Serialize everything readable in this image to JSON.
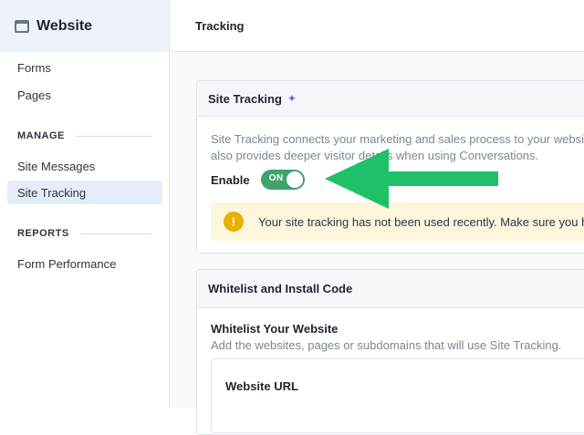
{
  "sidebar": {
    "title": "Website",
    "items": [
      {
        "label": "Forms"
      },
      {
        "label": "Pages"
      }
    ],
    "sections": [
      {
        "label": "MANAGE",
        "items": [
          {
            "label": "Site Messages"
          },
          {
            "label": "Site Tracking",
            "active": true
          }
        ]
      },
      {
        "label": "REPORTS",
        "items": [
          {
            "label": "Form Performance"
          }
        ]
      }
    ]
  },
  "header": {
    "title": "Tracking"
  },
  "site_tracking": {
    "title": "Site Tracking",
    "sparkle_icon": "sparkle-icon",
    "description_line1": "Site Tracking connects your marketing and sales process to your websi",
    "description_line2": "also provides deeper visitor details when using Conversations.",
    "enable_label": "Enable",
    "toggle_state": "ON",
    "notice_text": "Your site tracking has not been used recently. Make sure you h"
  },
  "whitelist": {
    "title": "Whitelist and Install Code",
    "subtitle": "Whitelist Your Website",
    "description": "Add the websites, pages or subdomains that will use Site Tracking.",
    "url_label": "Website URL"
  },
  "colors": {
    "toggle_on": "#3fa36b",
    "annotation_arrow": "#1ec06a",
    "warning": "#e5b000"
  }
}
